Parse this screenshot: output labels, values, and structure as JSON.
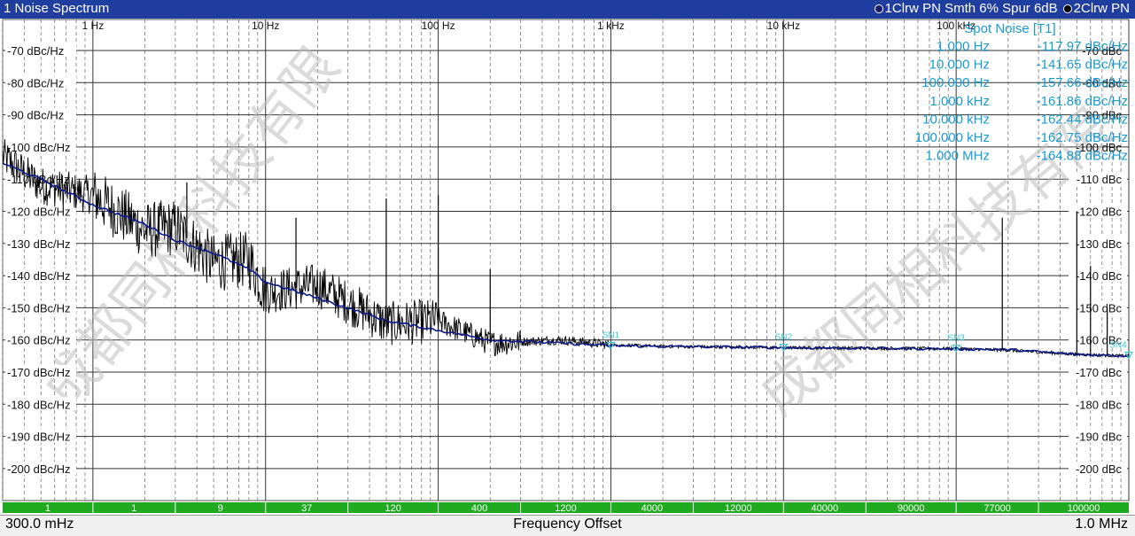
{
  "title": "1 Noise Spectrum",
  "trace_info": [
    {
      "label": "1Clrw PN Smth 6% Spur 6dB",
      "color": "#1a1a6e"
    },
    {
      "label": "2Clrw PN",
      "color": "#000000"
    }
  ],
  "status": {
    "start": "300.0 mHz",
    "center": "Frequency Offset",
    "stop": "1.0 MHz"
  },
  "colors": {
    "trace1": "#0a1a8c",
    "trace2": "#000000",
    "accent": "#1a9bd0",
    "marker": "#3cc8d8",
    "bar": "#1faa1f"
  },
  "chart_data": {
    "type": "line",
    "xscale": "log",
    "xlim": [
      0.3,
      1000000
    ],
    "ylim": [
      -210,
      -60
    ],
    "xlabel": "Frequency Offset",
    "grid": true,
    "x_ticks": [
      "1 Hz",
      "10 Hz",
      "100 Hz",
      "1 kHz",
      "10 kHz",
      "100 kHz"
    ],
    "y_ticks_left": [
      "-70 dBc/Hz",
      "-80 dBc/Hz",
      "-90 dBc/Hz",
      "-100 dBc/Hz",
      "-110 dBc/Hz",
      "-120 dBc/Hz",
      "-130 dBc/Hz",
      "-140 dBc/Hz",
      "-150 dBc/Hz",
      "-160 dBc/Hz",
      "-170 dBc/Hz",
      "-180 dBc/Hz",
      "-190 dBc/Hz",
      "-200 dBc/Hz"
    ],
    "y_ticks_right": [
      "-70 dBc",
      "-80 dBc",
      "-90 dBc",
      "-100 dBc",
      "-110 dBc",
      "-120 dBc",
      "-130 dBc",
      "-140 dBc",
      "-150 dBc",
      "-160 dBc",
      "-170 dBc",
      "-180 dBc",
      "-190 dBc",
      "-200 dBc"
    ],
    "series": [
      {
        "name": "1Clrw PN Smth 6% Spur 6dB",
        "x": [
          0.3,
          0.5,
          1,
          2,
          3,
          5,
          8,
          10,
          20,
          50,
          100,
          200,
          500,
          1000,
          2000,
          10000,
          100000,
          200000,
          500000,
          1000000
        ],
        "y": [
          -105,
          -110,
          -118,
          -124,
          -129,
          -133,
          -138,
          -142,
          -147,
          -154,
          -157,
          -160,
          -161,
          -161.8,
          -162,
          -162.4,
          -162.8,
          -163,
          -164.5,
          -165
        ]
      },
      {
        "name": "2Clrw PN",
        "x": [
          0.3,
          0.5,
          1,
          2,
          3,
          5,
          8,
          10,
          20,
          50,
          100,
          200,
          500,
          1000,
          2000,
          10000,
          100000,
          200000,
          500000,
          1000000
        ],
        "y": [
          -103,
          -112,
          -115,
          -126,
          -125,
          -136,
          -135,
          -145,
          -143,
          -155,
          -154,
          -161,
          -160,
          -161.5,
          -162,
          -162.4,
          -162.7,
          -163.2,
          -164.5,
          -165
        ]
      }
    ],
    "spurs": [
      {
        "x": 3.5,
        "y": -111
      },
      {
        "x": 15,
        "y": -122
      },
      {
        "x": 50,
        "y": -116
      },
      {
        "x": 100,
        "y": -115
      },
      {
        "x": 200,
        "y": -138
      },
      {
        "x": 185000,
        "y": -122
      },
      {
        "x": 500000,
        "y": -120
      },
      {
        "x": 600000,
        "y": -137
      },
      {
        "x": 750000,
        "y": -150
      }
    ],
    "spot_noise": {
      "title": "Spot Noise [T1]",
      "rows": [
        {
          "freq": "1.000 Hz",
          "value": "-117.97 dBc/Hz"
        },
        {
          "freq": "10.000 Hz",
          "value": "-141.65 dBc/Hz"
        },
        {
          "freq": "100.000 Hz",
          "value": "-157.66 dBc/Hz"
        },
        {
          "freq": "1.000 kHz",
          "value": "-161.86 dBc/Hz"
        },
        {
          "freq": "10.000 kHz",
          "value": "-162.44 dBc/Hz"
        },
        {
          "freq": "100.000 kHz",
          "value": "-162.75 dBc/Hz"
        },
        {
          "freq": "1.000 MHz",
          "value": "-164.88 dBc/Hz"
        }
      ]
    },
    "markers": [
      {
        "label": "SN1",
        "x": 1000,
        "y": -161.86
      },
      {
        "label": "SN2",
        "x": 10000,
        "y": -162.44
      },
      {
        "label": "SN3",
        "x": 100000,
        "y": -162.75
      },
      {
        "label": "SN4",
        "x": 1000000,
        "y": -164.88
      }
    ],
    "bottom_bar_values": [
      "1",
      "1",
      "9",
      "37",
      "120",
      "400",
      "1200",
      "4000",
      "12000",
      "40000",
      "90000",
      "77000",
      "100000"
    ]
  },
  "watermark": "成都同相科技有限"
}
